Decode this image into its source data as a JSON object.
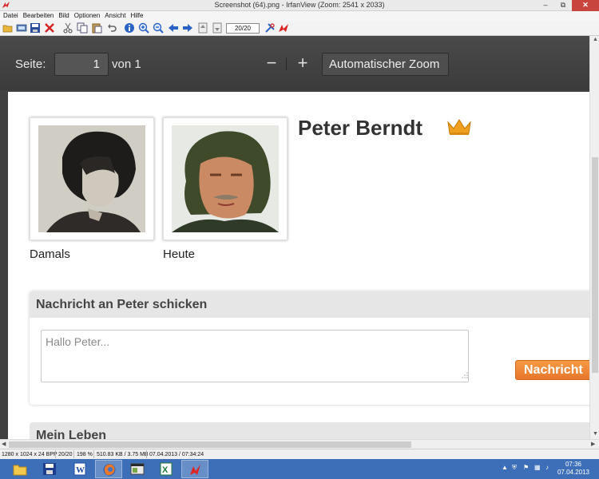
{
  "window": {
    "title": "Screenshot (64).png - IrfanView (Zoom: 2541 x 2033)",
    "minimize_glyph": "–",
    "maximize_glyph": "⧉",
    "close_glyph": "✕"
  },
  "menu": [
    "Datei",
    "Bearbeiten",
    "Bild",
    "Optionen",
    "Ansicht",
    "Hilfe"
  ],
  "toolbar": {
    "page_value": "20/20",
    "icons": [
      "open-folder-icon",
      "slideshow-icon",
      "save-icon",
      "delete-icon",
      "cut-icon",
      "copy-icon",
      "paste-icon",
      "undo-icon",
      "info-icon",
      "zoom-in-icon",
      "zoom-out-icon",
      "prev-icon",
      "next-icon",
      "first-page-icon",
      "last-page-icon",
      "settings-icon",
      "irfanview-icon"
    ]
  },
  "pdf_viewer": {
    "page_label": "Seite:",
    "page_input": "1",
    "page_of": "von 1",
    "zoom_out_glyph": "−",
    "zoom_in_glyph": "+",
    "zoom_select": "Automatischer Zoom"
  },
  "profile": {
    "name": "Peter Berndt",
    "photo_then_caption": "Damals",
    "photo_now_caption": "Heute",
    "message_header": "Nachricht an Peter schicken",
    "message_placeholder": "Hallo Peter...",
    "send_button": "Nachricht",
    "life_header": "Mein Leben"
  },
  "statusbar": {
    "image_info": "1280 x 1024 x 24 BPP",
    "page": "20/20",
    "zoom": "198 %",
    "size": "510.83 KB / 3.75 MB",
    "date": "07.04.2013 / 07:34:24"
  },
  "taskbar": {
    "apps": [
      "explorer-icon",
      "floppy-icon",
      "word-icon",
      "firefox-icon",
      "window-icon",
      "excel-icon",
      "irfanview-icon"
    ],
    "clock_time": "07:36",
    "clock_date": "07.04.2013"
  },
  "colors": {
    "accent_orange": "#e8772b",
    "taskbar_blue": "#3d6fb8",
    "pdf_toolbar": "#404040"
  }
}
